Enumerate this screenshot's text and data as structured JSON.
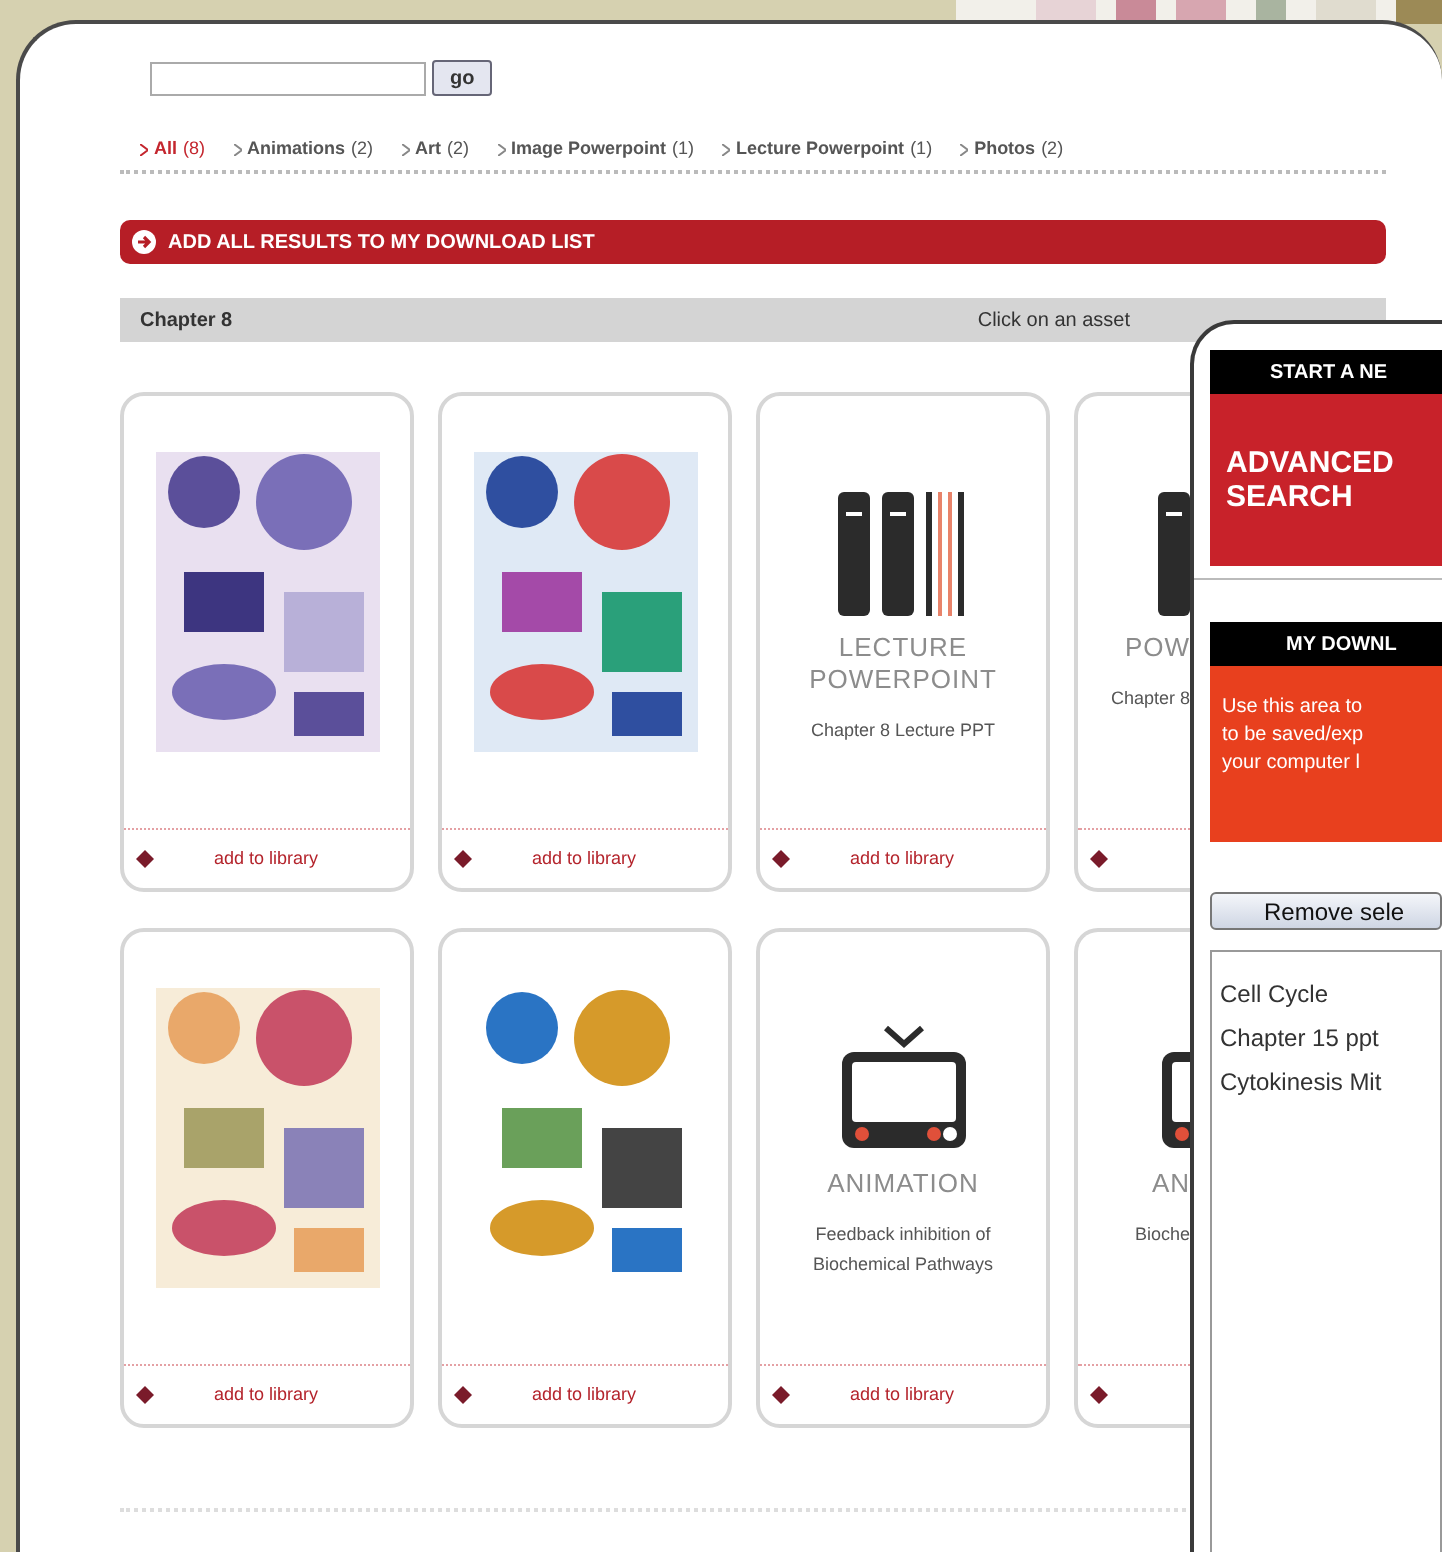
{
  "search": {
    "button": "go"
  },
  "filters": [
    {
      "label": "All",
      "count": "(8)",
      "selected": true
    },
    {
      "label": "Animations",
      "count": "(2)",
      "selected": false
    },
    {
      "label": "Art",
      "count": "(2)",
      "selected": false
    },
    {
      "label": "Image Powerpoint",
      "count": "(1)",
      "selected": false
    },
    {
      "label": "Lecture Powerpoint",
      "count": "(1)",
      "selected": false
    },
    {
      "label": "Photos",
      "count": "(2)",
      "selected": false
    }
  ],
  "add_all_button": "ADD ALL RESULTS TO MY DOWNLOAD LIST",
  "section": {
    "title": "Chapter 8",
    "hint": "Click on an asset"
  },
  "card_rows": [
    [
      {
        "kind": "picture",
        "link": "add to library"
      },
      {
        "kind": "picture",
        "link": "add to library"
      },
      {
        "kind": "lecture",
        "type_label": "LECTURE POWERPOINT",
        "caption": "Chapter 8 Lecture PPT",
        "link": "add to library"
      },
      {
        "kind": "partial_lecture",
        "type_label": "POW",
        "caption": "Chapter 8"
      }
    ],
    [
      {
        "kind": "picture",
        "link": "add to library"
      },
      {
        "kind": "picture",
        "link": "add to library"
      },
      {
        "kind": "animation",
        "type_label": "ANIMATION",
        "caption": "Feedback inhibition of Biochemical Pathways",
        "link": "add to library"
      },
      {
        "kind": "partial_animation",
        "type_label": "AN",
        "caption": "Bioche"
      }
    ]
  ],
  "side_panel": {
    "new_search": {
      "header": "START A NE",
      "button": "ADVANCED SEARCH"
    },
    "download": {
      "header": "MY DOWNL",
      "note_lines": [
        "Use this area to",
        "to be saved/exp",
        "your computer l"
      ],
      "remove_button": "Remove sele",
      "items": [
        "Cell Cycle",
        "Chapter 15 ppt",
        "Cytokinesis Mit"
      ]
    }
  }
}
